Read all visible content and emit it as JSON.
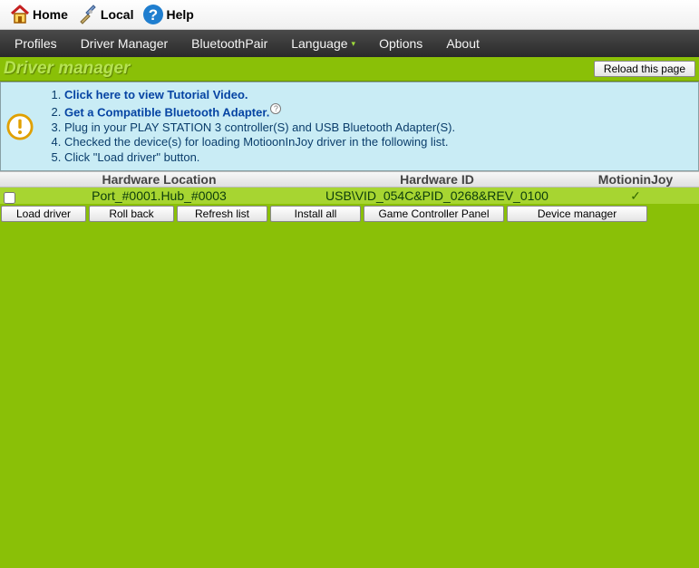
{
  "topnav": {
    "home": "Home",
    "local": "Local",
    "help": "Help"
  },
  "menubar": [
    "Profiles",
    "Driver Manager",
    "BluetoothPair",
    "Language",
    "Options",
    "About"
  ],
  "page_title": "Driver manager",
  "reload_label": "Reload this page",
  "steps": {
    "s1": "Click here to view Tutorial Video.",
    "s2": "Get a Compatible Bluetooth Adapter.",
    "s3": "Plug in your PLAY STATION 3 controller(S) and USB Bluetooth Adapter(S).",
    "s4": "Checked the device(s) for loading MotioonInJoy driver in the following list.",
    "s5": "Click \"Load driver\" button."
  },
  "table": {
    "headers": {
      "loc": "Hardware Location",
      "id": "Hardware ID",
      "joy": "MotioninJoy"
    },
    "row": {
      "loc": "Port_#0001.Hub_#0003",
      "id": "USB\\VID_054C&PID_0268&REV_0100",
      "joy": "✓"
    }
  },
  "buttons": {
    "load": "Load driver",
    "rollback": "Roll back",
    "refresh": "Refresh list",
    "install": "Install all",
    "gcp": "Game Controller Panel",
    "devmgr": "Device manager"
  }
}
